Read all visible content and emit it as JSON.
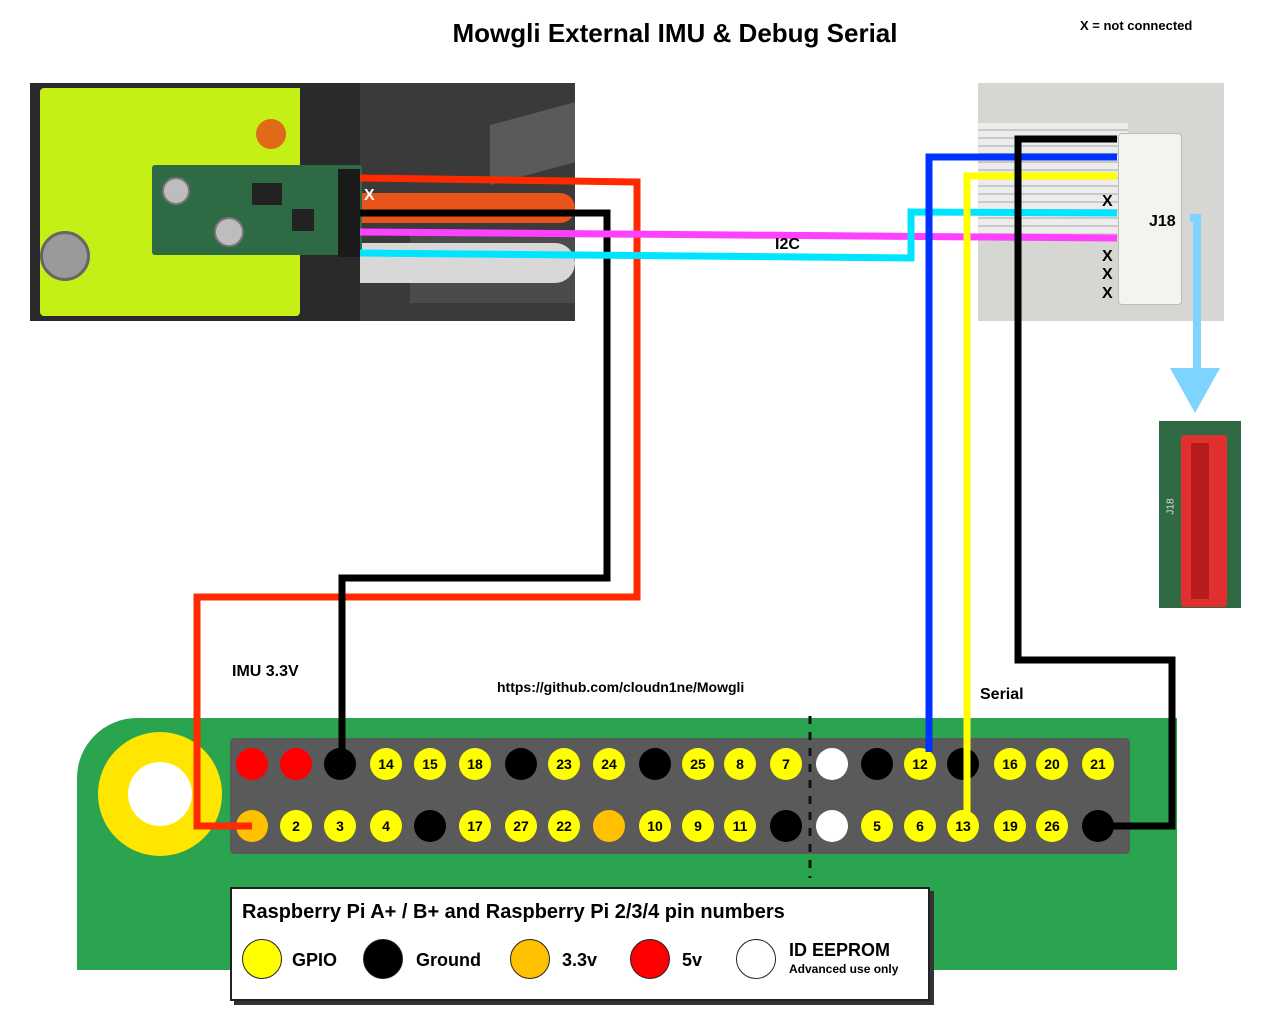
{
  "title": "Mowgli External IMU & Debug Serial",
  "not_connected_note": "X = not connected",
  "labels": {
    "imu_x": "X",
    "i2c": "I2C",
    "j18": "J18",
    "j18_x": [
      "X",
      "X",
      "X",
      "X"
    ],
    "imu_power": "IMU 3.3V",
    "url": "https://github.com/cloudn1ne/Mowgli",
    "serial": "Serial",
    "board_j18": "J18"
  },
  "pins": {
    "top_row": [
      {
        "label": "",
        "type": "v5"
      },
      {
        "label": "",
        "type": "v5"
      },
      {
        "label": "",
        "type": "ground"
      },
      {
        "label": "14",
        "type": "gpio"
      },
      {
        "label": "15",
        "type": "gpio"
      },
      {
        "label": "18",
        "type": "gpio"
      },
      {
        "label": "",
        "type": "ground"
      },
      {
        "label": "23",
        "type": "gpio"
      },
      {
        "label": "24",
        "type": "gpio"
      },
      {
        "label": "",
        "type": "ground"
      },
      {
        "label": "25",
        "type": "gpio"
      },
      {
        "label": "8",
        "type": "gpio"
      },
      {
        "label": "7",
        "type": "gpio"
      },
      {
        "label": "",
        "type": "eeprom"
      },
      {
        "label": "",
        "type": "ground"
      },
      {
        "label": "12",
        "type": "gpio"
      },
      {
        "label": "",
        "type": "ground"
      },
      {
        "label": "16",
        "type": "gpio"
      },
      {
        "label": "20",
        "type": "gpio"
      },
      {
        "label": "21",
        "type": "gpio"
      }
    ],
    "bottom_row": [
      {
        "label": "",
        "type": "v33"
      },
      {
        "label": "2",
        "type": "gpio"
      },
      {
        "label": "3",
        "type": "gpio"
      },
      {
        "label": "4",
        "type": "gpio"
      },
      {
        "label": "",
        "type": "ground"
      },
      {
        "label": "17",
        "type": "gpio"
      },
      {
        "label": "27",
        "type": "gpio"
      },
      {
        "label": "22",
        "type": "gpio"
      },
      {
        "label": "",
        "type": "v33"
      },
      {
        "label": "10",
        "type": "gpio"
      },
      {
        "label": "9",
        "type": "gpio"
      },
      {
        "label": "11",
        "type": "gpio"
      },
      {
        "label": "",
        "type": "ground"
      },
      {
        "label": "",
        "type": "eeprom"
      },
      {
        "label": "5",
        "type": "gpio"
      },
      {
        "label": "6",
        "type": "gpio"
      },
      {
        "label": "13",
        "type": "gpio"
      },
      {
        "label": "19",
        "type": "gpio"
      },
      {
        "label": "26",
        "type": "gpio"
      },
      {
        "label": "",
        "type": "ground"
      }
    ]
  },
  "legend": {
    "title": "Raspberry Pi A+ / B+ and Raspberry Pi 2/3/4 pin numbers",
    "items": [
      {
        "label": "GPIO",
        "color": "#ffff00"
      },
      {
        "label": "Ground",
        "color": "#000000"
      },
      {
        "label": "3.3v",
        "color": "#ffc000"
      },
      {
        "label": "5v",
        "color": "#ff0000"
      },
      {
        "label": "ID EEPROM",
        "color": "#ffffff",
        "note": "Advanced use only"
      }
    ]
  },
  "wire_colors": {
    "power": "#ff2a00",
    "ground": "#000000",
    "i2c_sda": "#ff40ff",
    "i2c_scl": "#00e5ff",
    "serial_tx": "#0033ff",
    "serial_rx": "#ffff00",
    "arrow": "#7fd4ff"
  }
}
